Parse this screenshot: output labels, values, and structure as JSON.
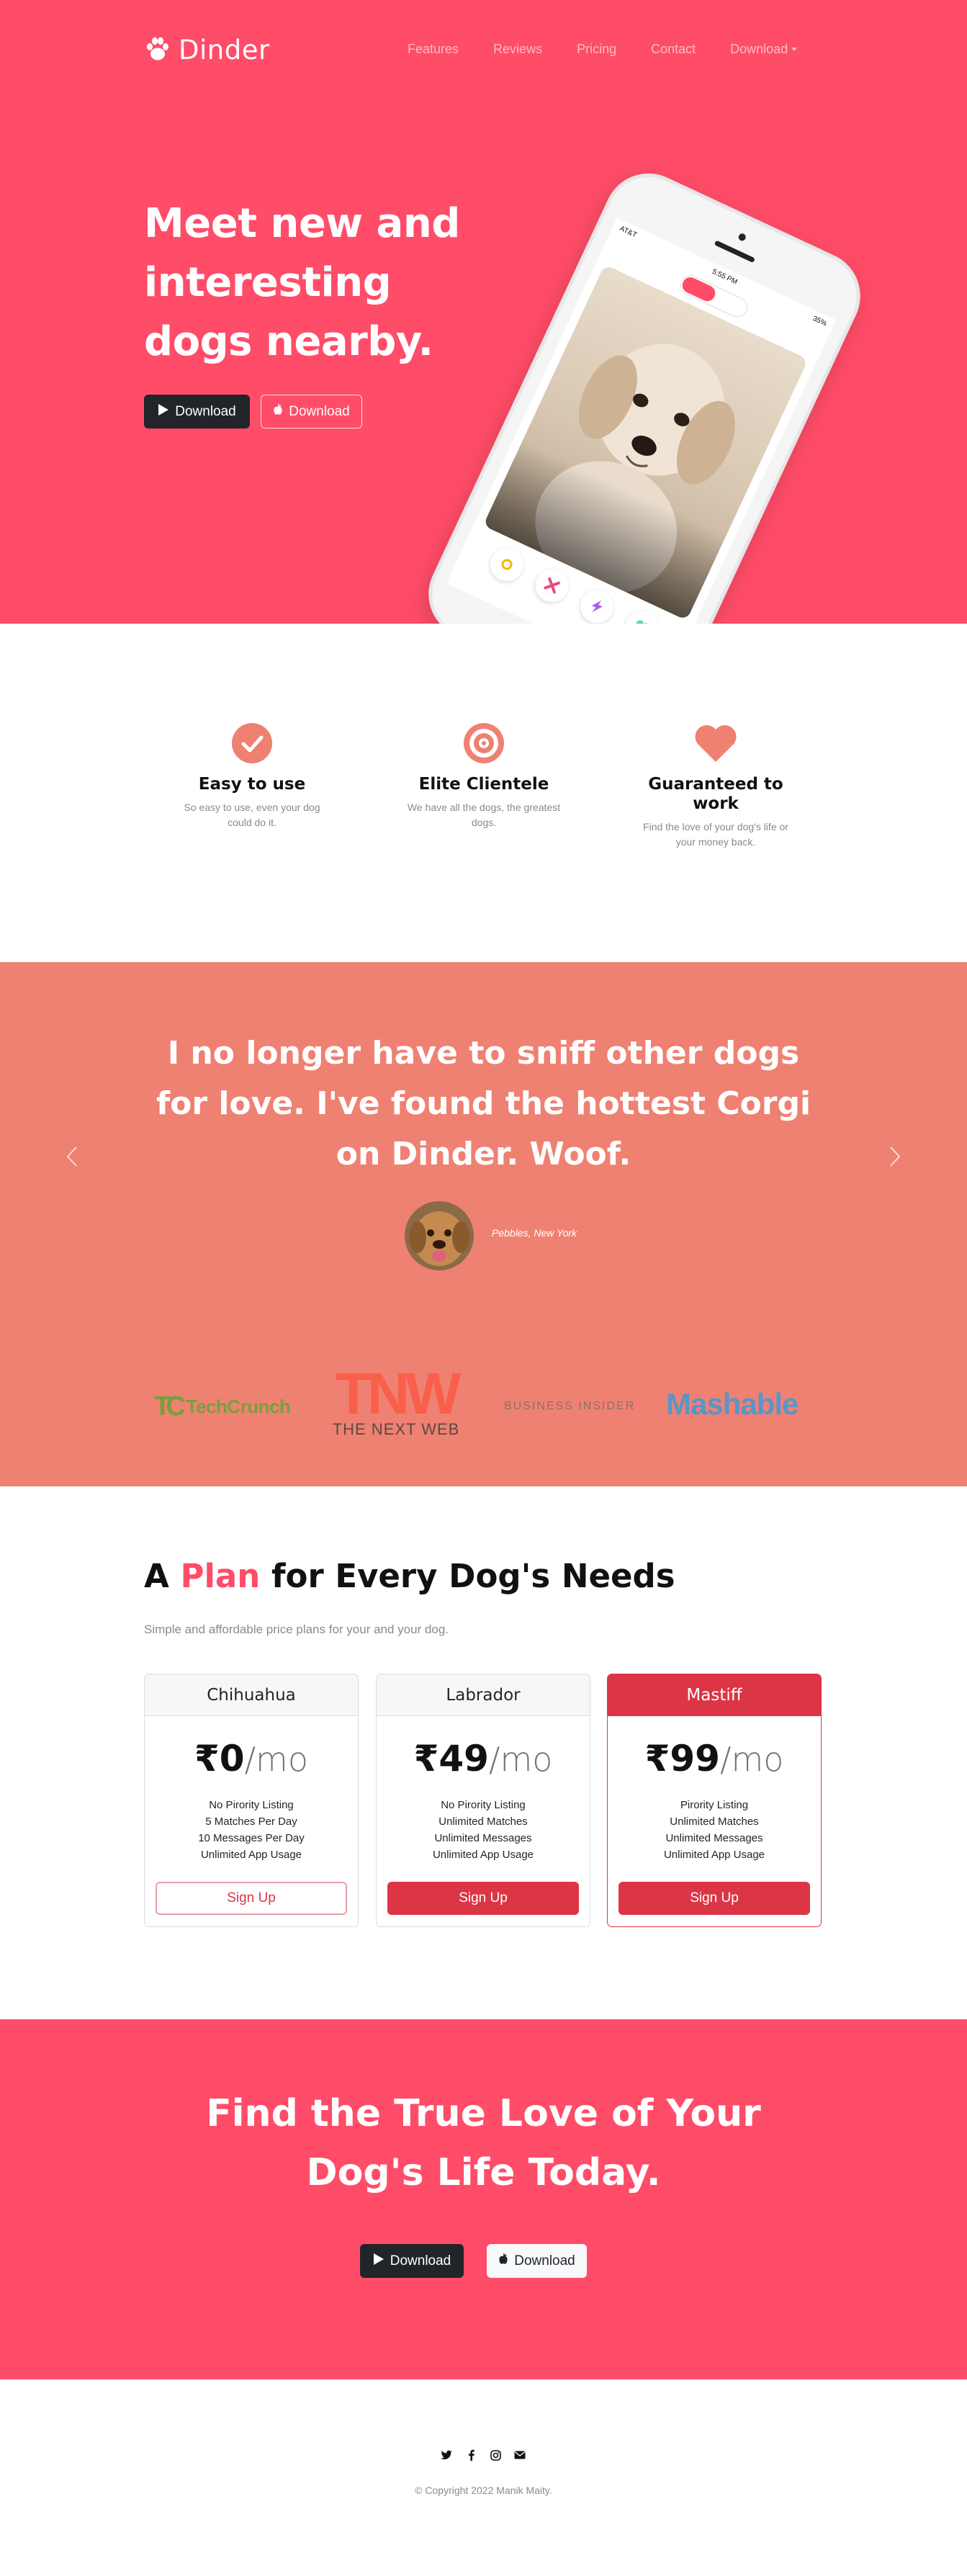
{
  "colors": {
    "brand_primary": "#ff4c68",
    "testimonial_bg": "#ef8172",
    "danger": "#dc3545",
    "dark": "#212529",
    "muted": "#8a8a8a"
  },
  "navbar": {
    "brand": "Dinder",
    "brand_icon": "paw-icon",
    "items": [
      "Features",
      "Reviews",
      "Pricing",
      "Contact"
    ],
    "dropdown": "Download"
  },
  "hero": {
    "title": "Meet new and interesting dogs nearby.",
    "buttons": [
      {
        "label": "Download",
        "icon": "google-play-icon"
      },
      {
        "label": "Download",
        "icon": "apple-icon"
      }
    ],
    "phone": {
      "carrier": "AT&T",
      "time": "5:55 PM",
      "battery": "35%"
    }
  },
  "features": [
    {
      "icon": "check-circle-icon",
      "title": "Easy to use",
      "text": "So easy to use, even your dog could do it."
    },
    {
      "icon": "bullseye-icon",
      "title": "Elite Clientele",
      "text": "We have all the dogs, the greatest dogs."
    },
    {
      "icon": "heart-icon",
      "title": "Guaranteed to work",
      "text": "Find the love of your dog's life or your money back."
    }
  ],
  "testimonial": {
    "quote": "I no longer have to sniff other dogs for love. I've found the hottest Corgi on Dinder. Woof.",
    "author": "Pebbles, New York"
  },
  "press": {
    "techcrunch": "TechCrunch",
    "tnw_mark": "TNW",
    "tnw_sub": "THE NEXT WEB",
    "business_insider": "BUSINESS INSIDER",
    "mashable": "Mashable"
  },
  "pricing": {
    "title_before": "A",
    "title_accent": "Plan",
    "title_after": "for Every Dog's Needs",
    "subtitle": "Simple and affordable price plans for your and your dog.",
    "plans": [
      {
        "name": "Chihuahua",
        "amount": "₹0",
        "per": "/mo",
        "features": [
          "No Pirority Listing",
          "5 Matches Per Day",
          "10 Messages Per Day",
          "Unlimited App Usage"
        ],
        "button": "Sign Up"
      },
      {
        "name": "Labrador",
        "amount": "₹49",
        "per": "/mo",
        "features": [
          "No Pirority Listing",
          "Unlimited Matches",
          "Unlimited Messages",
          "Unlimited App Usage"
        ],
        "button": "Sign Up"
      },
      {
        "name": "Mastiff",
        "amount": "₹99",
        "per": "/mo",
        "features": [
          "Pirority Listing",
          "Unlimited Matches",
          "Unlimited Messages",
          "Unlimited App Usage"
        ],
        "button": "Sign Up"
      }
    ]
  },
  "cta": {
    "title": "Find the True Love of Your Dog's Life Today.",
    "buttons": [
      {
        "label": "Download",
        "icon": "google-play-icon"
      },
      {
        "label": "Download",
        "icon": "apple-icon"
      }
    ]
  },
  "footer": {
    "social": [
      "twitter-icon",
      "facebook-icon",
      "instagram-icon",
      "envelope-icon"
    ],
    "copyright": "© Copyright 2022 Manik Maity."
  }
}
